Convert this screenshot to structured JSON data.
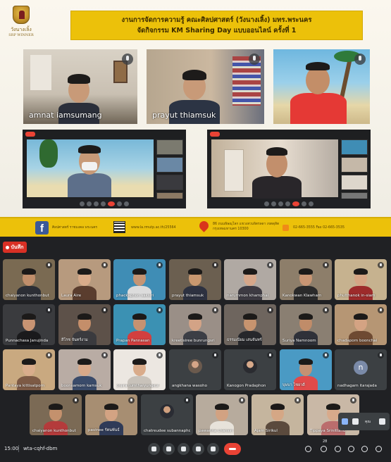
{
  "poster": {
    "logo_lines": [
      "",
      "วังนางเลิ้ง",
      "SRP WINNER"
    ],
    "title_line1": "งานการจัดการความรู้ คณะศิลปศาสตร์ (วังนางเลิ้ง) มทร.พระนคร",
    "title_line2": "จัดกิจกรรม KM Sharing Day แบบออนไลน์ ครั้งที่ 1",
    "speakers": [
      {
        "name": "amnat iamsumang"
      },
      {
        "name": "prayut thiamsuk"
      },
      {
        "name": ""
      }
    ],
    "contact": {
      "facebook_glyph": "f",
      "facebook_text": "ศิลปศาสตร์ ราชมงคล พระนคร",
      "qr_url": "www.la.rmutp.ac.th/25564",
      "address": "86 ถนนพิษณุโลก แขวงสวนจิตรลดา เขตดุสิต กรุงเทพมหานคร 10300",
      "phone": "02-665-3555  Fax 02-665-3535"
    }
  },
  "meet": {
    "recording_label": "บันทึก",
    "participants": [
      {
        "name": "chaiyanon kunthonbut",
        "type": "video",
        "bg": "#7a6a52",
        "skin": "#c08e6b",
        "shirt": "#2c2e35"
      },
      {
        "name": "Laura Aire",
        "type": "video",
        "bg": "#b79a7e",
        "skin": "#d8ab8a",
        "shirt": "#5a3d2e"
      },
      {
        "name": "phackaphon saksiri",
        "type": "video",
        "bg": "#3f8db5",
        "skin": "#c59574",
        "shirt": "#dcdcdc"
      },
      {
        "name": "prayut thiamsuk",
        "type": "video",
        "bg": "#6b5f50",
        "skin": "#c8976f",
        "shirt": "#2d3140"
      },
      {
        "name": "narummon khamphai",
        "type": "video",
        "bg": "#b0a9a3",
        "skin": "#d6a78a",
        "shirt": "#3d3a42"
      },
      {
        "name": "Kanokwan Klawharn",
        "type": "video",
        "bg": "#8d7e6a",
        "skin": "#c89573",
        "shirt": "#2a2a2a"
      },
      {
        "name": "phutthanok in-siam",
        "type": "video",
        "bg": "#c6b28f",
        "skin": "#d5a584",
        "shirt": "#9d2b2b"
      },
      {
        "name": "Punnachasa Janujinda",
        "type": "video",
        "bg": "#3a3b3e",
        "skin": "#c89473",
        "shirt": "#1a1a1c"
      },
      {
        "name": "สิโรช จันทร์งาม",
        "type": "video",
        "bg": "#5d5149",
        "skin": "#c48e6a",
        "shirt": "#3a3a3e"
      },
      {
        "name": "Prapan Pannasan",
        "type": "video",
        "bg": "#3b91b3",
        "skin": "#c59271",
        "shirt": "#d23f3f"
      },
      {
        "name": "kreetisiree bunrungsri",
        "type": "video",
        "bg": "#9a8f87",
        "skin": "#d3a386",
        "shirt": "#3c3e45"
      },
      {
        "name": "ธรรมเนียม เสนจันทร์",
        "type": "video",
        "bg": "#6e655e",
        "skin": "#c7946f",
        "shirt": "#26272b"
      },
      {
        "name": "Suriya Namnoom",
        "type": "video",
        "bg": "#8a7f72",
        "skin": "#c08c69",
        "shirt": "#2f3139"
      },
      {
        "name": "chadaporn boonchai",
        "type": "video",
        "bg": "#b69674",
        "skin": "#d4a383",
        "shirt": "#6e4a32"
      },
      {
        "name": "Pantaya kittisatporn",
        "type": "video",
        "bg": "#c9a980",
        "skin": "#d9ad8c",
        "shirt": "#7d5a45"
      },
      {
        "name": "boonsamorn kamsuk",
        "type": "video",
        "bg": "#b9aca4",
        "skin": "#d8a989",
        "shirt": "#3a4b6a"
      },
      {
        "name": "onjira tumthaiyungkul",
        "type": "video",
        "bg": "#ece7e1",
        "skin": "#d9ab8a",
        "shirt": "#c8c2ba"
      },
      {
        "name": "angkhana wasoho",
        "type": "avatar",
        "bg": "#3c4043",
        "skin": "#d5a587",
        "shirt": "#6b5a4d"
      },
      {
        "name": "Kanogon Pradaphon",
        "type": "avatar",
        "bg": "#3c4043",
        "skin": "#d7a98a",
        "shirt": "#2a2b30"
      },
      {
        "name": "บุษบา ไชยาดี",
        "type": "video",
        "bg": "#4a9ac4",
        "skin": "#c49172",
        "shirt": "#e04a4a"
      },
      {
        "name": "nadhagarn itarajada",
        "type": "letter",
        "letter": "n",
        "bg": "#3c4043"
      },
      {
        "name": "chaiyanon kunthonbut",
        "type": "video",
        "bg": "#7b6a55",
        "skin": "#c4916d",
        "shirt": "#b43b3b"
      },
      {
        "name": "pavinee รัตนพันธ์",
        "type": "video",
        "bg": "#a78e72",
        "skin": "#d3a383",
        "shirt": "#2f3b58"
      },
      {
        "name": "chatreudee subannaphong",
        "type": "avatar",
        "bg": "#3c4043",
        "skin": "#d0a07f",
        "shirt": "#2a2c33"
      },
      {
        "name": "pawarina chansiri",
        "type": "video",
        "bg": "#b7ab9d",
        "skin": "#d2a282",
        "shirt": "#e7e2da"
      },
      {
        "name": "Ajarn Sirikul",
        "type": "video",
        "bg": "#c5b59e",
        "skin": "#d5a785",
        "shirt": "#5b4a3d"
      },
      {
        "name": "Tippaya Srinittanu",
        "type": "video",
        "bg": "#c9b8a6",
        "skin": "#d8aa8b",
        "shirt": "#bb6d6d"
      }
    ],
    "self_view_label": "คุณ",
    "participant_count": "28",
    "bottom_bar": {
      "time": "15:00",
      "meeting_code": "wta-cqhf-dbm"
    }
  }
}
